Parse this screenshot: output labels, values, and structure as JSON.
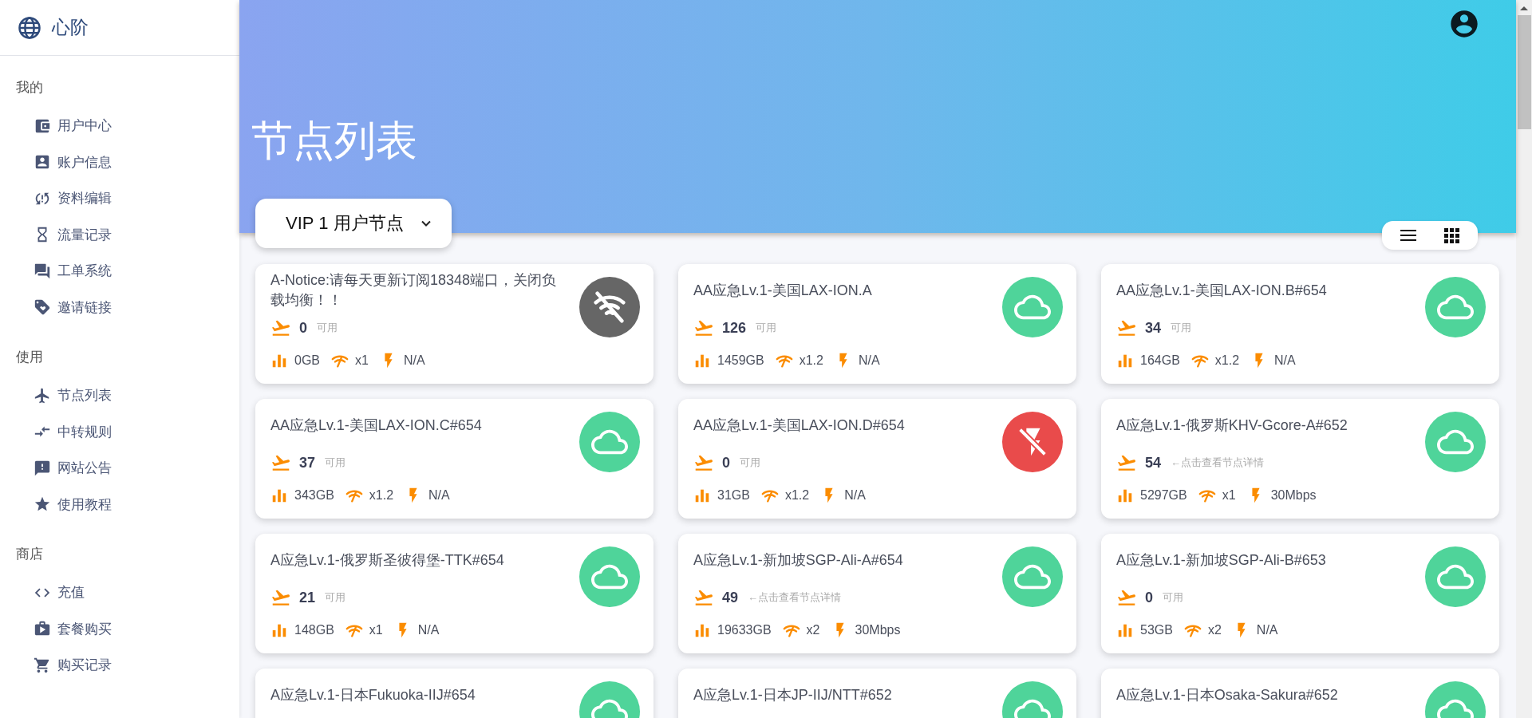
{
  "brand": {
    "name": "心阶"
  },
  "sidebar": {
    "sections": [
      {
        "title": "我的",
        "items": [
          {
            "label": "用户中心"
          },
          {
            "label": "账户信息"
          },
          {
            "label": "资料编辑"
          },
          {
            "label": "流量记录"
          },
          {
            "label": "工单系统"
          },
          {
            "label": "邀请链接"
          }
        ]
      },
      {
        "title": "使用",
        "items": [
          {
            "label": "节点列表"
          },
          {
            "label": "中转规则"
          },
          {
            "label": "网站公告"
          },
          {
            "label": "使用教程"
          }
        ]
      },
      {
        "title": "商店",
        "items": [
          {
            "label": "充值"
          },
          {
            "label": "套餐购买"
          },
          {
            "label": "购买记录"
          }
        ]
      }
    ]
  },
  "header": {
    "title": "节点列表"
  },
  "group_select": {
    "value": "VIP 1 用户节点"
  },
  "nodes": [
    {
      "name": "A-Notice:请每天更新订阅18348端口，关闭负载均衡！！",
      "online": "0",
      "hint": "可用",
      "traffic": "0GB",
      "ratio": "x1",
      "speed": "N/A",
      "kind": "offline"
    },
    {
      "name": "AA应急Lv.1-美国LAX-ION.A",
      "online": "126",
      "hint": "可用",
      "traffic": "1459GB",
      "ratio": "x1.2",
      "speed": "N/A",
      "kind": "online"
    },
    {
      "name": "AA应急Lv.1-美国LAX-ION.B#654",
      "online": "34",
      "hint": "可用",
      "traffic": "164GB",
      "ratio": "x1.2",
      "speed": "N/A",
      "kind": "online"
    },
    {
      "name": "AA应急Lv.1-美国LAX-ION.C#654",
      "online": "37",
      "hint": "可用",
      "traffic": "343GB",
      "ratio": "x1.2",
      "speed": "N/A",
      "kind": "online"
    },
    {
      "name": "AA应急Lv.1-美国LAX-ION.D#654",
      "online": "0",
      "hint": "可用",
      "traffic": "31GB",
      "ratio": "x1.2",
      "speed": "N/A",
      "kind": "error"
    },
    {
      "name": "A应急Lv.1-俄罗斯KHV-Gcore-A#652",
      "online": "54",
      "hint": "←点击查看节点详情",
      "traffic": "5297GB",
      "ratio": "x1",
      "speed": "30Mbps",
      "kind": "online"
    },
    {
      "name": "A应急Lv.1-俄罗斯圣彼得堡-TTK#654",
      "online": "21",
      "hint": "可用",
      "traffic": "148GB",
      "ratio": "x1",
      "speed": "N/A",
      "kind": "online"
    },
    {
      "name": "A应急Lv.1-新加坡SGP-Ali-A#654",
      "online": "49",
      "hint": "←点击查看节点详情",
      "traffic": "19633GB",
      "ratio": "x2",
      "speed": "30Mbps",
      "kind": "online"
    },
    {
      "name": "A应急Lv.1-新加坡SGP-Ali-B#653",
      "online": "0",
      "hint": "可用",
      "traffic": "53GB",
      "ratio": "x2",
      "speed": "N/A",
      "kind": "online"
    },
    {
      "name": "A应急Lv.1-日本Fukuoka-IIJ#654",
      "kind": "online"
    },
    {
      "name": "A应急Lv.1-日本JP-IIJ/NTT#652",
      "kind": "online"
    },
    {
      "name": "A应急Lv.1-日本Osaka-Sakura#652",
      "kind": "online"
    }
  ]
}
